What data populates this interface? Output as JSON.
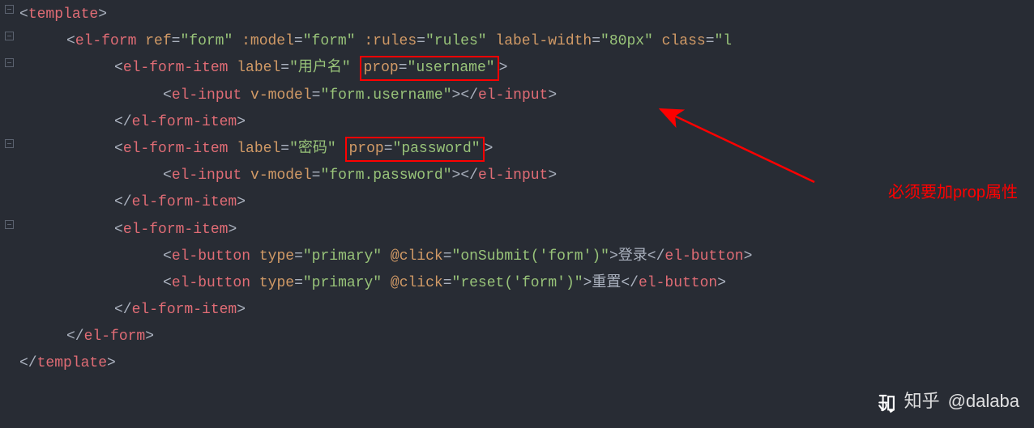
{
  "foldRows": [
    0,
    1,
    2,
    5,
    8
  ],
  "lines": [
    {
      "indent": 0,
      "segs": [
        {
          "t": "<",
          "c": "br"
        },
        {
          "t": "template",
          "c": "tag"
        },
        {
          "t": ">",
          "c": "br"
        }
      ]
    },
    {
      "indent": 1,
      "segs": [
        {
          "t": "<",
          "c": "br"
        },
        {
          "t": "el-form",
          "c": "tag"
        },
        {
          "t": " ",
          "c": "br"
        },
        {
          "t": "ref",
          "c": "attr"
        },
        {
          "t": "=",
          "c": "punc"
        },
        {
          "t": "\"form\"",
          "c": "str"
        },
        {
          "t": " ",
          "c": "br"
        },
        {
          "t": ":model",
          "c": "attr"
        },
        {
          "t": "=",
          "c": "punc"
        },
        {
          "t": "\"form\"",
          "c": "str"
        },
        {
          "t": " ",
          "c": "br"
        },
        {
          "t": ":rules",
          "c": "attr"
        },
        {
          "t": "=",
          "c": "punc"
        },
        {
          "t": "\"rules\"",
          "c": "str"
        },
        {
          "t": " ",
          "c": "br"
        },
        {
          "t": "label-width",
          "c": "attr"
        },
        {
          "t": "=",
          "c": "punc"
        },
        {
          "t": "\"80px\"",
          "c": "str"
        },
        {
          "t": " ",
          "c": "br"
        },
        {
          "t": "class",
          "c": "attr"
        },
        {
          "t": "=",
          "c": "punc"
        },
        {
          "t": "\"l",
          "c": "str"
        }
      ]
    },
    {
      "indent": 2,
      "segs": [
        {
          "t": "<",
          "c": "br"
        },
        {
          "t": "el-form-item",
          "c": "tag"
        },
        {
          "t": " ",
          "c": "br"
        },
        {
          "t": "label",
          "c": "attr"
        },
        {
          "t": "=",
          "c": "punc"
        },
        {
          "t": "\"用户名\"",
          "c": "str"
        },
        {
          "t": " ",
          "c": "br"
        },
        {
          "box": true,
          "inner": [
            {
              "t": "prop",
              "c": "attr"
            },
            {
              "t": "=",
              "c": "punc"
            },
            {
              "t": "\"username\"",
              "c": "str"
            }
          ]
        },
        {
          "t": ">",
          "c": "br"
        }
      ]
    },
    {
      "indent": 3,
      "segs": [
        {
          "t": "<",
          "c": "br"
        },
        {
          "t": "el-input",
          "c": "tag"
        },
        {
          "t": " ",
          "c": "br"
        },
        {
          "t": "v-model",
          "c": "attr"
        },
        {
          "t": "=",
          "c": "punc"
        },
        {
          "t": "\"form.username\"",
          "c": "str"
        },
        {
          "t": ">",
          "c": "br"
        },
        {
          "t": "</",
          "c": "br"
        },
        {
          "t": "el-input",
          "c": "tag"
        },
        {
          "t": ">",
          "c": "br"
        }
      ]
    },
    {
      "indent": 2,
      "segs": [
        {
          "t": "</",
          "c": "br"
        },
        {
          "t": "el-form-item",
          "c": "tag"
        },
        {
          "t": ">",
          "c": "br"
        }
      ]
    },
    {
      "indent": 2,
      "segs": [
        {
          "t": "<",
          "c": "br"
        },
        {
          "t": "el-form-item",
          "c": "tag"
        },
        {
          "t": " ",
          "c": "br"
        },
        {
          "t": "label",
          "c": "attr"
        },
        {
          "t": "=",
          "c": "punc"
        },
        {
          "t": "\"密码\"",
          "c": "str"
        },
        {
          "t": " ",
          "c": "br"
        },
        {
          "box": true,
          "inner": [
            {
              "t": "prop",
              "c": "attr"
            },
            {
              "t": "=",
              "c": "punc"
            },
            {
              "t": "\"password\"",
              "c": "str"
            }
          ]
        },
        {
          "t": ">",
          "c": "br"
        }
      ]
    },
    {
      "indent": 3,
      "segs": [
        {
          "t": "<",
          "c": "br"
        },
        {
          "t": "el-input",
          "c": "tag"
        },
        {
          "t": " ",
          "c": "br"
        },
        {
          "t": "v-model",
          "c": "attr"
        },
        {
          "t": "=",
          "c": "punc"
        },
        {
          "t": "\"form.password\"",
          "c": "str"
        },
        {
          "t": ">",
          "c": "br"
        },
        {
          "t": "</",
          "c": "br"
        },
        {
          "t": "el-input",
          "c": "tag"
        },
        {
          "t": ">",
          "c": "br"
        }
      ]
    },
    {
      "indent": 2,
      "segs": [
        {
          "t": "</",
          "c": "br"
        },
        {
          "t": "el-form-item",
          "c": "tag"
        },
        {
          "t": ">",
          "c": "br"
        }
      ]
    },
    {
      "indent": 2,
      "segs": [
        {
          "t": "<",
          "c": "br"
        },
        {
          "t": "el-form-item",
          "c": "tag"
        },
        {
          "t": ">",
          "c": "br"
        }
      ]
    },
    {
      "indent": 3,
      "segs": [
        {
          "t": "<",
          "c": "br"
        },
        {
          "t": "el-button",
          "c": "tag"
        },
        {
          "t": " ",
          "c": "br"
        },
        {
          "t": "type",
          "c": "attr"
        },
        {
          "t": "=",
          "c": "punc"
        },
        {
          "t": "\"primary\"",
          "c": "str"
        },
        {
          "t": " ",
          "c": "br"
        },
        {
          "t": "@click",
          "c": "attr"
        },
        {
          "t": "=",
          "c": "punc"
        },
        {
          "t": "\"onSubmit('form')\"",
          "c": "str"
        },
        {
          "t": ">",
          "c": "br"
        },
        {
          "t": "登录",
          "c": "txt"
        },
        {
          "t": "</",
          "c": "br"
        },
        {
          "t": "el-button",
          "c": "tag"
        },
        {
          "t": ">",
          "c": "br"
        }
      ]
    },
    {
      "indent": 3,
      "segs": [
        {
          "t": "<",
          "c": "br"
        },
        {
          "t": "el-button",
          "c": "tag"
        },
        {
          "t": " ",
          "c": "br"
        },
        {
          "t": "type",
          "c": "attr"
        },
        {
          "t": "=",
          "c": "punc"
        },
        {
          "t": "\"primary\"",
          "c": "str"
        },
        {
          "t": " ",
          "c": "br"
        },
        {
          "t": "@click",
          "c": "attr"
        },
        {
          "t": "=",
          "c": "punc"
        },
        {
          "t": "\"reset('form')\"",
          "c": "str"
        },
        {
          "t": ">",
          "c": "br"
        },
        {
          "t": "重置",
          "c": "txt"
        },
        {
          "t": "</",
          "c": "br"
        },
        {
          "t": "el-button",
          "c": "tag"
        },
        {
          "t": ">",
          "c": "br"
        }
      ]
    },
    {
      "indent": 2,
      "segs": [
        {
          "t": "</",
          "c": "br"
        },
        {
          "t": "el-form-item",
          "c": "tag"
        },
        {
          "t": ">",
          "c": "br"
        }
      ]
    },
    {
      "indent": 1,
      "segs": [
        {
          "t": "</",
          "c": "br"
        },
        {
          "t": "el-form",
          "c": "tag"
        },
        {
          "t": ">",
          "c": "br"
        }
      ]
    },
    {
      "indent": 0,
      "segs": [
        {
          "t": "</",
          "c": "br"
        },
        {
          "t": "template",
          "c": "tag"
        },
        {
          "t": ">",
          "c": "br"
        }
      ]
    }
  ],
  "annotation": "必须要加prop属性",
  "watermark": {
    "site": "知乎",
    "user": "@dalaba"
  }
}
